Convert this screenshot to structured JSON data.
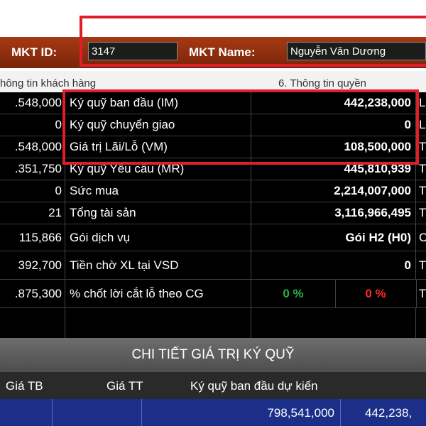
{
  "mkt": {
    "id_label": "MKT ID:",
    "id_value": "3147",
    "name_label": "MKT Name:",
    "name_value": "Nguyễn Văn Dương"
  },
  "sections": {
    "left": "hông tin khách hàng",
    "right": "6. Thông tin quyền"
  },
  "rows": [
    {
      "left": ".548,000",
      "label": "Ký quỹ ban đầu (IM)",
      "value": "442,238,000",
      "edge": "L"
    },
    {
      "left": "0",
      "label": "Ký quỹ chuyển giao",
      "value": "0",
      "edge": "L"
    },
    {
      "left": ".548,000",
      "label": "Giá trị Lãi/Lỗ (VM)",
      "value": "108,500,000",
      "edge": "T"
    },
    {
      "left": ".351,750",
      "label": "Ký quỹ Yêu cầu (MR)",
      "value": "445,810,939",
      "edge": "T"
    },
    {
      "left": "0",
      "label": "Sức mua",
      "value": "2,214,007,000",
      "edge": "T"
    },
    {
      "left": "21",
      "label": "Tổng tài sản",
      "value": "3,116,966,495",
      "edge": "T"
    },
    {
      "left": "115,866",
      "label": "Gói dịch vụ",
      "value": "Gói H2 (H0)",
      "edge": "C"
    },
    {
      "left": "392,700",
      "label": "Tiền chờ XL tại VSD",
      "value": "0",
      "edge": "T"
    },
    {
      "left": ".875,300",
      "label": "% chốt lời cắt lỗ theo CG",
      "value_a": "0 %",
      "value_b": "0 %",
      "edge": "T"
    },
    {
      "left": "",
      "label": "",
      "value": "",
      "edge": ""
    }
  ],
  "detail": {
    "title": "CHI TIẾT GIÁ TRỊ KÝ QUỸ",
    "headers": [
      "Giá TB",
      "Giá TT",
      "Ký quỹ ban đầu dự kiến"
    ],
    "row": [
      "798,541,000",
      "442,238,"
    ]
  },
  "colors": {
    "accent_red": "#e01e2a",
    "mkt_bar": "#8e2e0e",
    "positive": "#27b24a",
    "negative": "#ff2a2a",
    "detail_row": "#1b2f88"
  }
}
